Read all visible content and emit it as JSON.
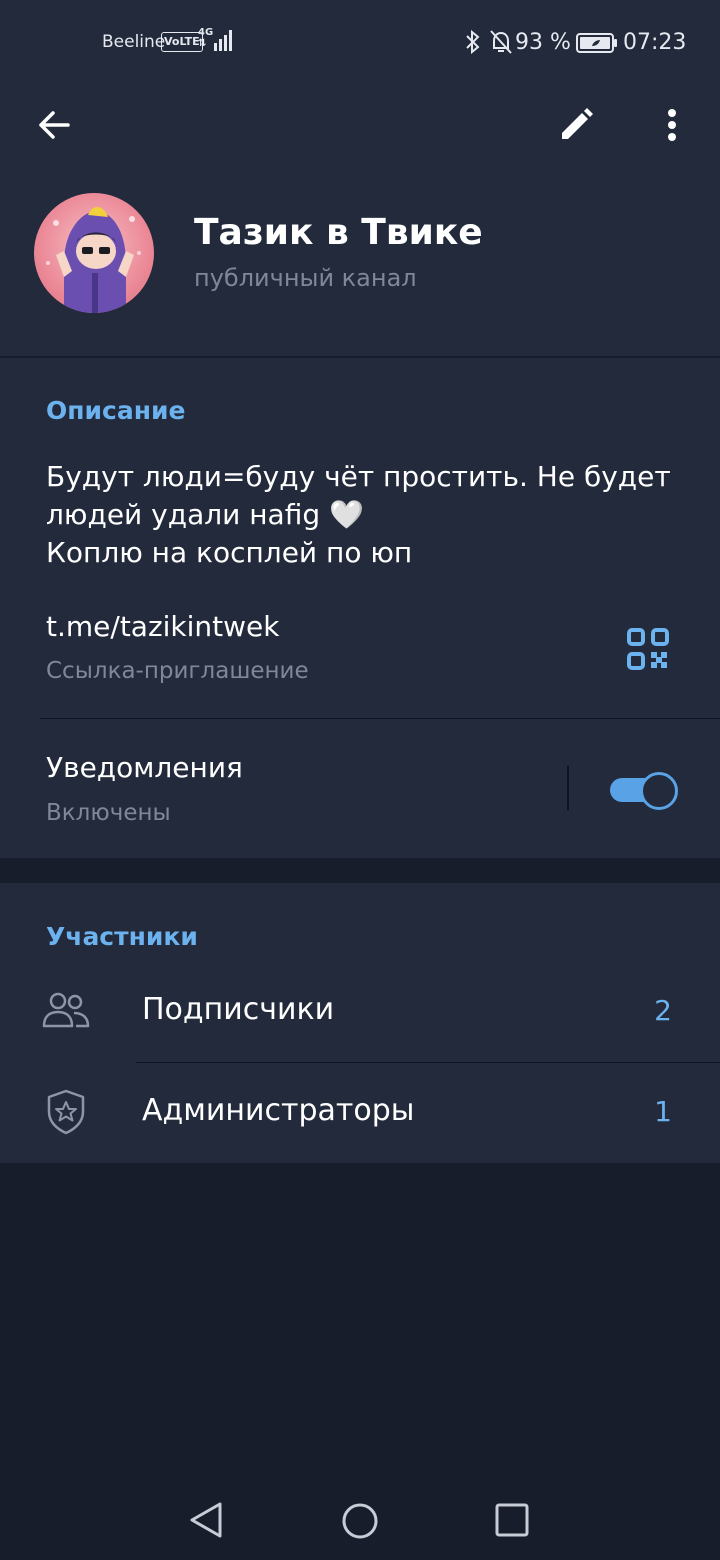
{
  "status_bar": {
    "carrier": "Beeline",
    "volte": "VoLTE",
    "network": "4G",
    "battery": "93 %",
    "time": "07:23"
  },
  "toolbar": {
    "icons": [
      "back-arrow-icon",
      "pencil-icon",
      "more-vertical-icon"
    ]
  },
  "channel": {
    "name": "Тазик в Твике",
    "type": "публичный канал"
  },
  "info": {
    "section_title": "Описание",
    "description_lines": [
      "Будут люди=буду чёт простить. Не будет",
      "людей удали наfig 🤍",
      "Коплю на косплей по юп"
    ],
    "link": "t.me/tazikintwek",
    "link_label": "Ссылка-приглашение",
    "notifications_label": "Уведомления",
    "notifications_state": "Включены",
    "notifications_on": true
  },
  "members": {
    "section_title": "Участники",
    "rows": [
      {
        "label": "Подписчики",
        "count": "2",
        "icon": "people-icon"
      },
      {
        "label": "Администраторы",
        "count": "1",
        "icon": "shield-star-icon"
      }
    ]
  },
  "colors": {
    "accent": "#6cb2ef",
    "toggle": "#5aa2e6",
    "card": "#222a3b",
    "background": "#171d2b",
    "secondary_text": "#7f8898"
  }
}
